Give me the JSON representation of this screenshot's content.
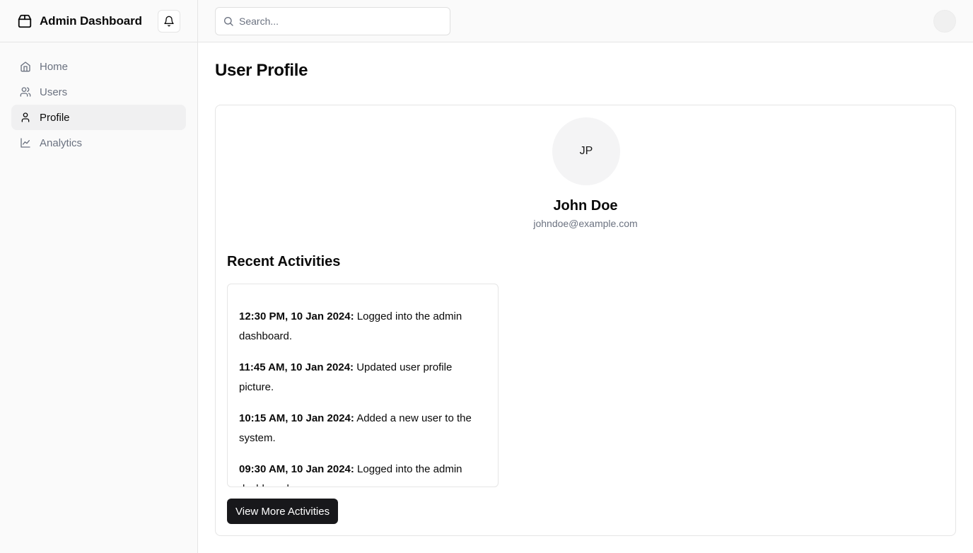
{
  "app": {
    "title": "Admin Dashboard"
  },
  "sidebar": {
    "items": [
      {
        "label": "Home",
        "icon": "home-icon",
        "active": false
      },
      {
        "label": "Users",
        "icon": "users-icon",
        "active": false
      },
      {
        "label": "Profile",
        "icon": "user-icon",
        "active": true
      },
      {
        "label": "Analytics",
        "icon": "line-chart-icon",
        "active": false
      }
    ]
  },
  "search": {
    "placeholder": "Search...",
    "value": ""
  },
  "page": {
    "title": "User Profile"
  },
  "profile": {
    "initials": "JP",
    "name": "John Doe",
    "email": "johndoe@example.com"
  },
  "activities": {
    "title": "Recent Activities",
    "items": [
      {
        "time": "12:30 PM, 10 Jan 2024:",
        "text": " Logged into the admin dashboard."
      },
      {
        "time": "11:45 AM, 10 Jan 2024:",
        "text": " Updated user profile picture."
      },
      {
        "time": "10:15 AM, 10 Jan 2024:",
        "text": " Added a new user to the system."
      },
      {
        "time": "09:30 AM, 10 Jan 2024:",
        "text": " Logged into the admin dashboard."
      }
    ],
    "button_label": "View More Activities"
  },
  "colors": {
    "sidebar_bg": "#fafafa",
    "active_item_bg": "#f0f0f1",
    "primary_button": "#18181b",
    "muted_text": "#6b7280",
    "border": "#e5e5e5"
  }
}
